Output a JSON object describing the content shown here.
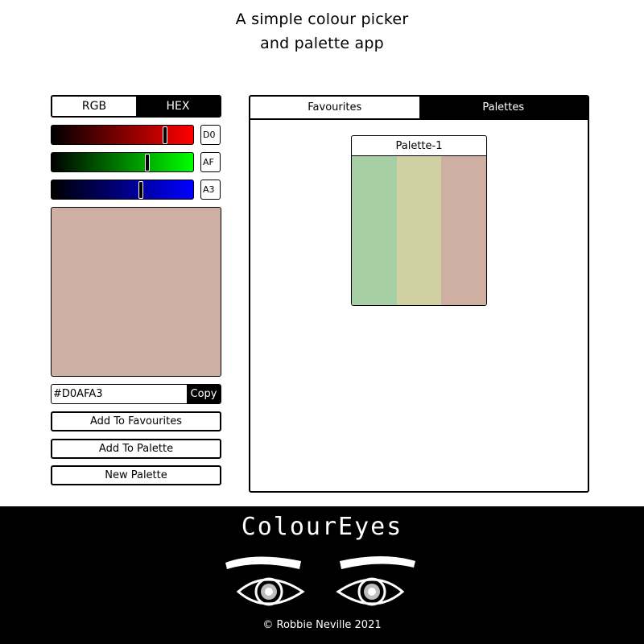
{
  "header": {
    "line1": "A simple colour picker",
    "line2": "and palette app"
  },
  "mode_toggle": {
    "options": [
      "RGB",
      "HEX"
    ],
    "active": "HEX"
  },
  "sliders": [
    {
      "channel": "red",
      "hex": "D0",
      "value": 208,
      "max": 255,
      "gradient_end": "#ff0000"
    },
    {
      "channel": "green",
      "hex": "AF",
      "value": 175,
      "max": 255,
      "gradient_end": "#00ff00"
    },
    {
      "channel": "blue",
      "hex": "A3",
      "value": 163,
      "max": 255,
      "gradient_end": "#0000ff"
    }
  ],
  "current_color": "#D0AFA3",
  "hex_field": {
    "value": "#D0AFA3",
    "copy_label": "Copy"
  },
  "actions": {
    "add_favourites": "Add To Favourites",
    "add_palette": "Add To Palette",
    "new_palette": "New Palette"
  },
  "panel": {
    "tabs": [
      "Favourites",
      "Palettes"
    ],
    "active_tab": "Palettes",
    "palettes": [
      {
        "name": "Palette-1",
        "colors": [
          "#A6CFA5",
          "#D0D0A3",
          "#D0AFA3"
        ]
      }
    ]
  },
  "footer": {
    "brand": "ColourEyes",
    "copyright": "© Robbie Neville 2021"
  }
}
